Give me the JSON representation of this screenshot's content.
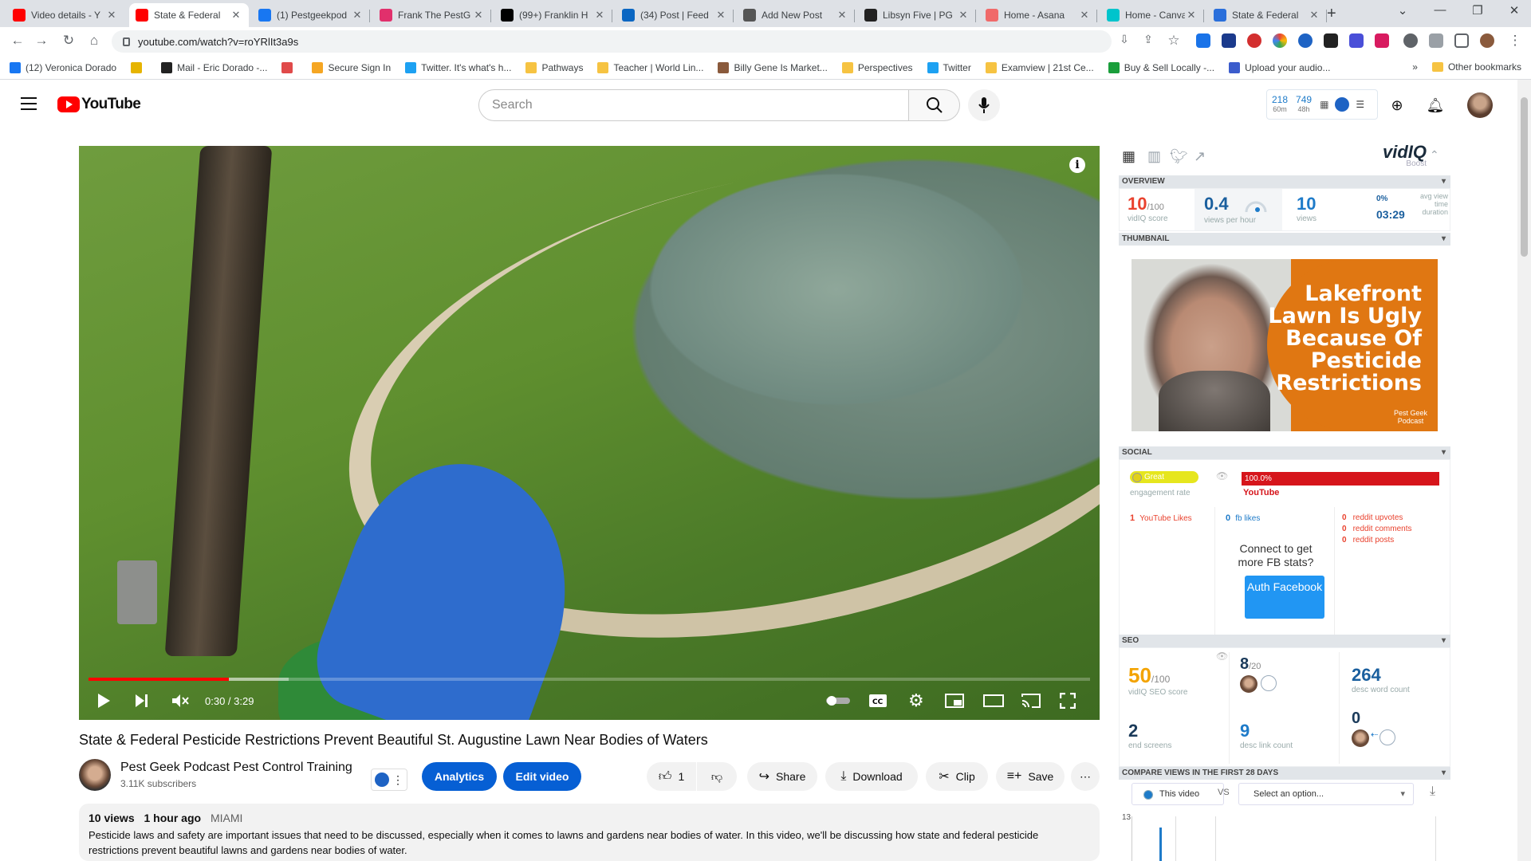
{
  "browser": {
    "tabs": [
      {
        "title": "Video details - Y",
        "color": "#ff0000"
      },
      {
        "title": "State & Federal",
        "color": "#ff0000"
      },
      {
        "title": "(1) Pestgeekpod",
        "color": "#1877f2"
      },
      {
        "title": "Frank The PestG",
        "color": "#e1306c"
      },
      {
        "title": "(99+) Franklin H",
        "color": "#000000"
      },
      {
        "title": "(34) Post | Feed",
        "color": "#0a66c2"
      },
      {
        "title": "Add New Post",
        "color": "#555555"
      },
      {
        "title": "Libsyn Five | PG",
        "color": "#222222"
      },
      {
        "title": "Home - Asana",
        "color": "#f06a6a"
      },
      {
        "title": "Home - Canva",
        "color": "#00c4cc"
      },
      {
        "title": "State & Federal",
        "color": "#2a6fdb"
      }
    ],
    "new_tab": "+",
    "url": "youtube.com/watch?v=roYRlIt3a9s",
    "bookmarks": [
      "(12) Veronica Dorado",
      "",
      "Mail - Eric Dorado -...",
      "",
      "Secure Sign In",
      "Twitter. It's what's h...",
      "Pathways",
      "Teacher | World Lin...",
      "Billy Gene Is Market...",
      "Perspectives",
      "Twitter",
      "Examview | 21st Ce...",
      "Buy & Sell Locally -...",
      "Upload your audio..."
    ],
    "more_bookmarks": "»",
    "other_bookmarks": "Other bookmarks"
  },
  "youtube": {
    "logo_text": "YouTube",
    "search_placeholder": "Search",
    "vidiq_mini": {
      "views_60m": "218",
      "label_60m": "60m",
      "views_48h": "749",
      "label_48h": "48h"
    }
  },
  "player": {
    "time": "0:30 / 3:29",
    "progress_fraction": 0.14,
    "buffer_fraction": 0.2
  },
  "video": {
    "title": "State & Federal Pesticide Restrictions Prevent Beautiful St. Augustine Lawn Near Bodies of Waters",
    "channel": "Pest Geek Podcast Pest Control Training",
    "subscribers": "3.11K subscribers",
    "analytics_label": "Analytics",
    "edit_label": "Edit video",
    "likes": "1",
    "share_label": "Share",
    "download_label": "Download",
    "clip_label": "Clip",
    "save_label": "Save",
    "more_label": "⋯",
    "views": "10 views",
    "age": "1 hour ago",
    "location": "MIAMI",
    "description": "Pesticide laws and safety are important issues that need to be discussed, especially when it comes to lawns and gardens near bodies of water. In this video, we'll be discussing how state and federal pesticide restrictions prevent beautiful lawns and gardens near bodies of water."
  },
  "vidiq": {
    "logo": "vidIQ",
    "logo_sub": "Boost",
    "overview": {
      "title": "OVERVIEW",
      "score": "10",
      "score_max": "/100",
      "score_label": "vidIQ score",
      "vph": "0.4",
      "vph_label": "views per hour",
      "views": "10",
      "views_label": "views",
      "pct": "0%",
      "duration": "03:29",
      "duration_label": "avg view time duration"
    },
    "thumbnail": {
      "title": "THUMBNAIL",
      "text": "Lakefront Lawn Is Ugly Because Of Pesticide Restrictions",
      "logo_text": "Pest Geek Podcast"
    },
    "social": {
      "title": "SOCIAL",
      "engagement_badge": "Great",
      "engagement_label": "engagement rate",
      "yt_pct": "100.0%",
      "yt_label": "YouTube",
      "yt_likes": "1",
      "yt_likes_label": "YouTube Likes",
      "fb_likes": "0",
      "fb_likes_label": "fb likes",
      "reddit": [
        {
          "value": "0",
          "label": "reddit upvotes"
        },
        {
          "value": "0",
          "label": "reddit comments"
        },
        {
          "value": "0",
          "label": "reddit posts"
        }
      ],
      "connect_text": "Connect to get more FB stats?",
      "auth_label": "Auth Facebook"
    },
    "seo": {
      "title": "SEO",
      "score": "50",
      "score_max": "/100",
      "score_label": "vidIQ SEO score",
      "tags": "8",
      "tags_max": "/20",
      "word_count": "264",
      "word_count_label": "desc word count",
      "end_screens": "2",
      "end_screens_label": "end screens",
      "link_count": "9",
      "link_count_label": "desc link count",
      "zero": "0"
    },
    "compare": {
      "title": "COMPARE VIEWS IN THE FIRST 28 DAYS",
      "this_video": "This video",
      "vs": "VS",
      "select_placeholder": "Select an option...",
      "y_top": "13"
    }
  }
}
